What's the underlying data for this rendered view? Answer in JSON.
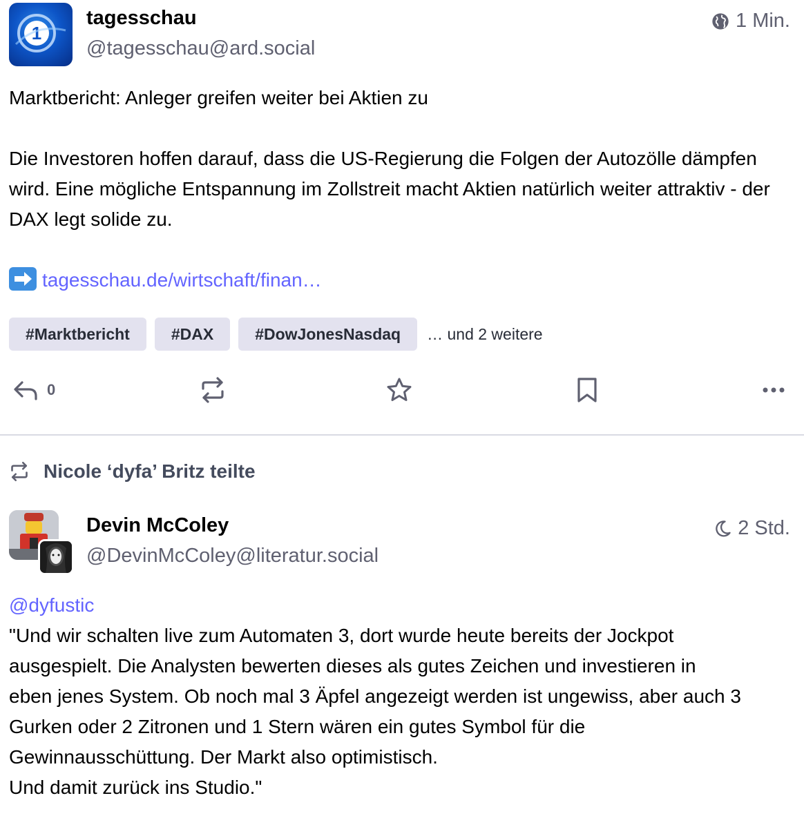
{
  "post1": {
    "display_name": "tagesschau",
    "handle": "@tagesschau@ard.social",
    "time": "1 Min.",
    "visibility_icon": "globe-icon",
    "paragraph1": "Marktbericht: Anleger greifen weiter bei Aktien zu",
    "paragraph2": "Die Investoren hoffen darauf, dass die US-Regierung die Folgen der Autozölle dämpfen wird. Eine mögliche Entspannung im Zollstreit macht Aktien natürlich weiter attraktiv - der DAX legt solide zu.",
    "link_text": "tagesschau.de/wirtschaft/finan…",
    "hashtags": [
      "#Marktbericht",
      "#DAX",
      "#DowJonesNasdaq"
    ],
    "hashtags_more": "… und 2 weitere",
    "reply_count": "0",
    "actions": {
      "reply_icon": "reply-icon",
      "boost_icon": "boost-icon",
      "favourite_icon": "star-icon",
      "bookmark_icon": "bookmark-icon",
      "more_icon": "more-icon"
    }
  },
  "post2": {
    "reblog_label": "Nicole ‘dyfa’ Britz teilte",
    "display_name": "Devin McColey",
    "handle": "@DevinMcColey@literatur.social",
    "time": "2 Std.",
    "visibility_icon": "moon-icon",
    "mention": "@dyfustic",
    "lines": [
      "\"Und wir schalten live zum Automaten 3, dort wurde heute bereits der Jockpot",
      "ausgespielt. Die Analysten bewerten dieses als gutes Zeichen und investieren in",
      "eben jenes System. Ob noch mal 3 Äpfel angezeigt werden ist ungewiss, aber auch 3",
      "Gurken oder 2 Zitronen und 1 Stern wären ein gutes Symbol für die",
      "Gewinnausschüttung. Der Markt also optimistisch.",
      "Und damit zurück ins Studio.\""
    ]
  },
  "colors": {
    "link": "#6364ff",
    "secondary_text": "#5f6070",
    "tag_bg": "#e3e2ef",
    "divider": "#d9dae3"
  }
}
